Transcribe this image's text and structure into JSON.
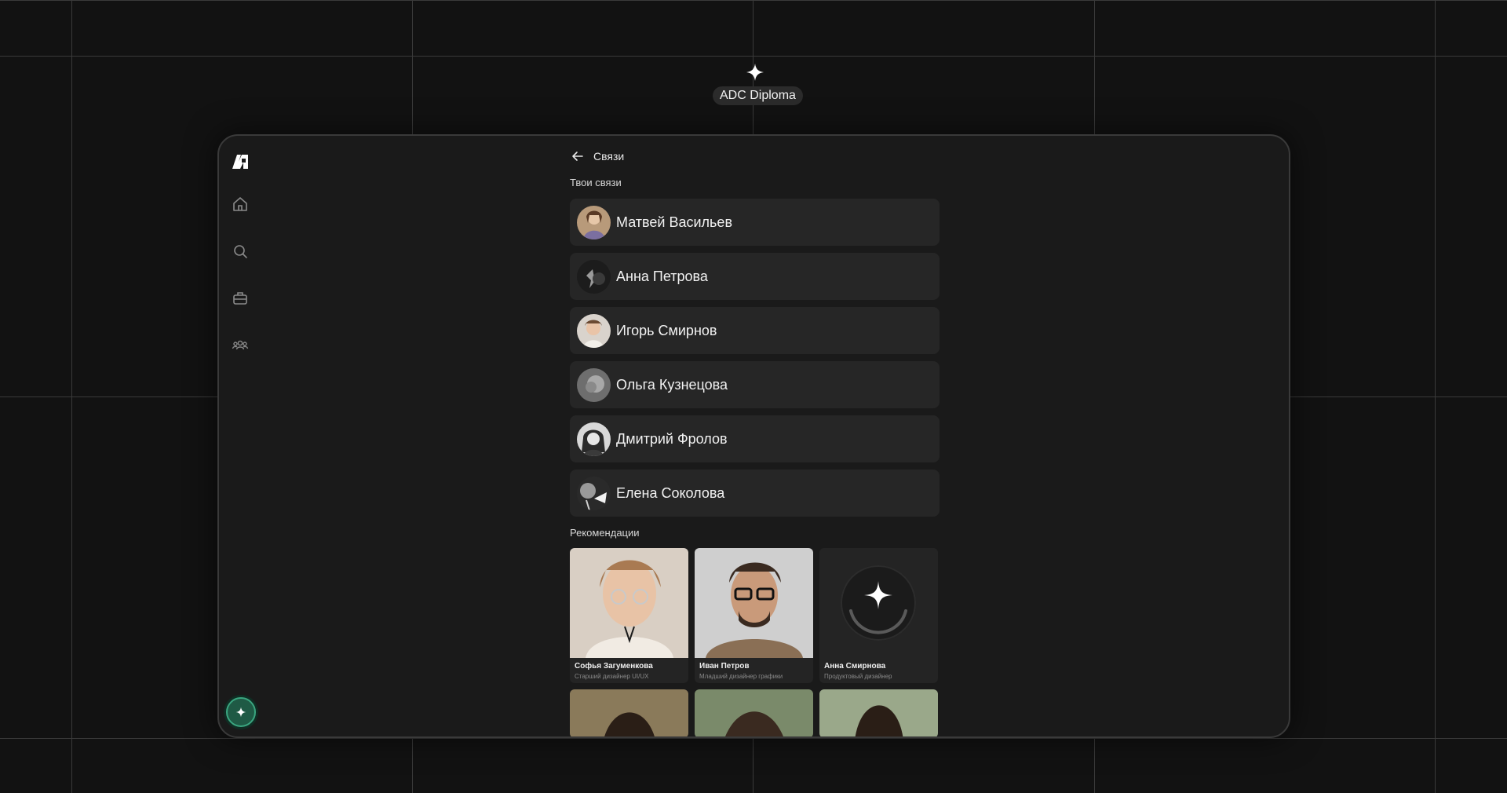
{
  "badge": {
    "label": "ADC Diploma",
    "icon": "sparkle-icon"
  },
  "sidebar": {
    "logo": "app-logo",
    "items": [
      {
        "name": "home",
        "icon": "home-icon"
      },
      {
        "name": "search",
        "icon": "search-icon"
      },
      {
        "name": "jobs",
        "icon": "briefcase-icon"
      },
      {
        "name": "connections",
        "icon": "people-icon"
      }
    ],
    "ai_button": {
      "icon": "sparkle-icon",
      "accent": "#3aa57f"
    }
  },
  "header": {
    "title": "Связи"
  },
  "connections": {
    "title": "Твои связи",
    "items": [
      {
        "name": "Матвей Васильев"
      },
      {
        "name": "Анна Петрова"
      },
      {
        "name": "Игорь Смирнов"
      },
      {
        "name": "Ольга Кузнецова"
      },
      {
        "name": "Дмитрий Фролов"
      },
      {
        "name": "Елена Соколова"
      }
    ]
  },
  "recommendations": {
    "title": "Рекомендации",
    "cards": [
      {
        "name": "Софья Загуменкова",
        "role": "Старший дизайнер UI/UX"
      },
      {
        "name": "Иван Петров",
        "role": "Младший дизайнер графики"
      },
      {
        "name": "Анна Смирнова",
        "role": "Продуктовый дизайнер"
      }
    ]
  },
  "colors": {
    "background": "#121212",
    "window": "#1a1a1a",
    "card": "#262626",
    "accent": "#3aa57f"
  }
}
